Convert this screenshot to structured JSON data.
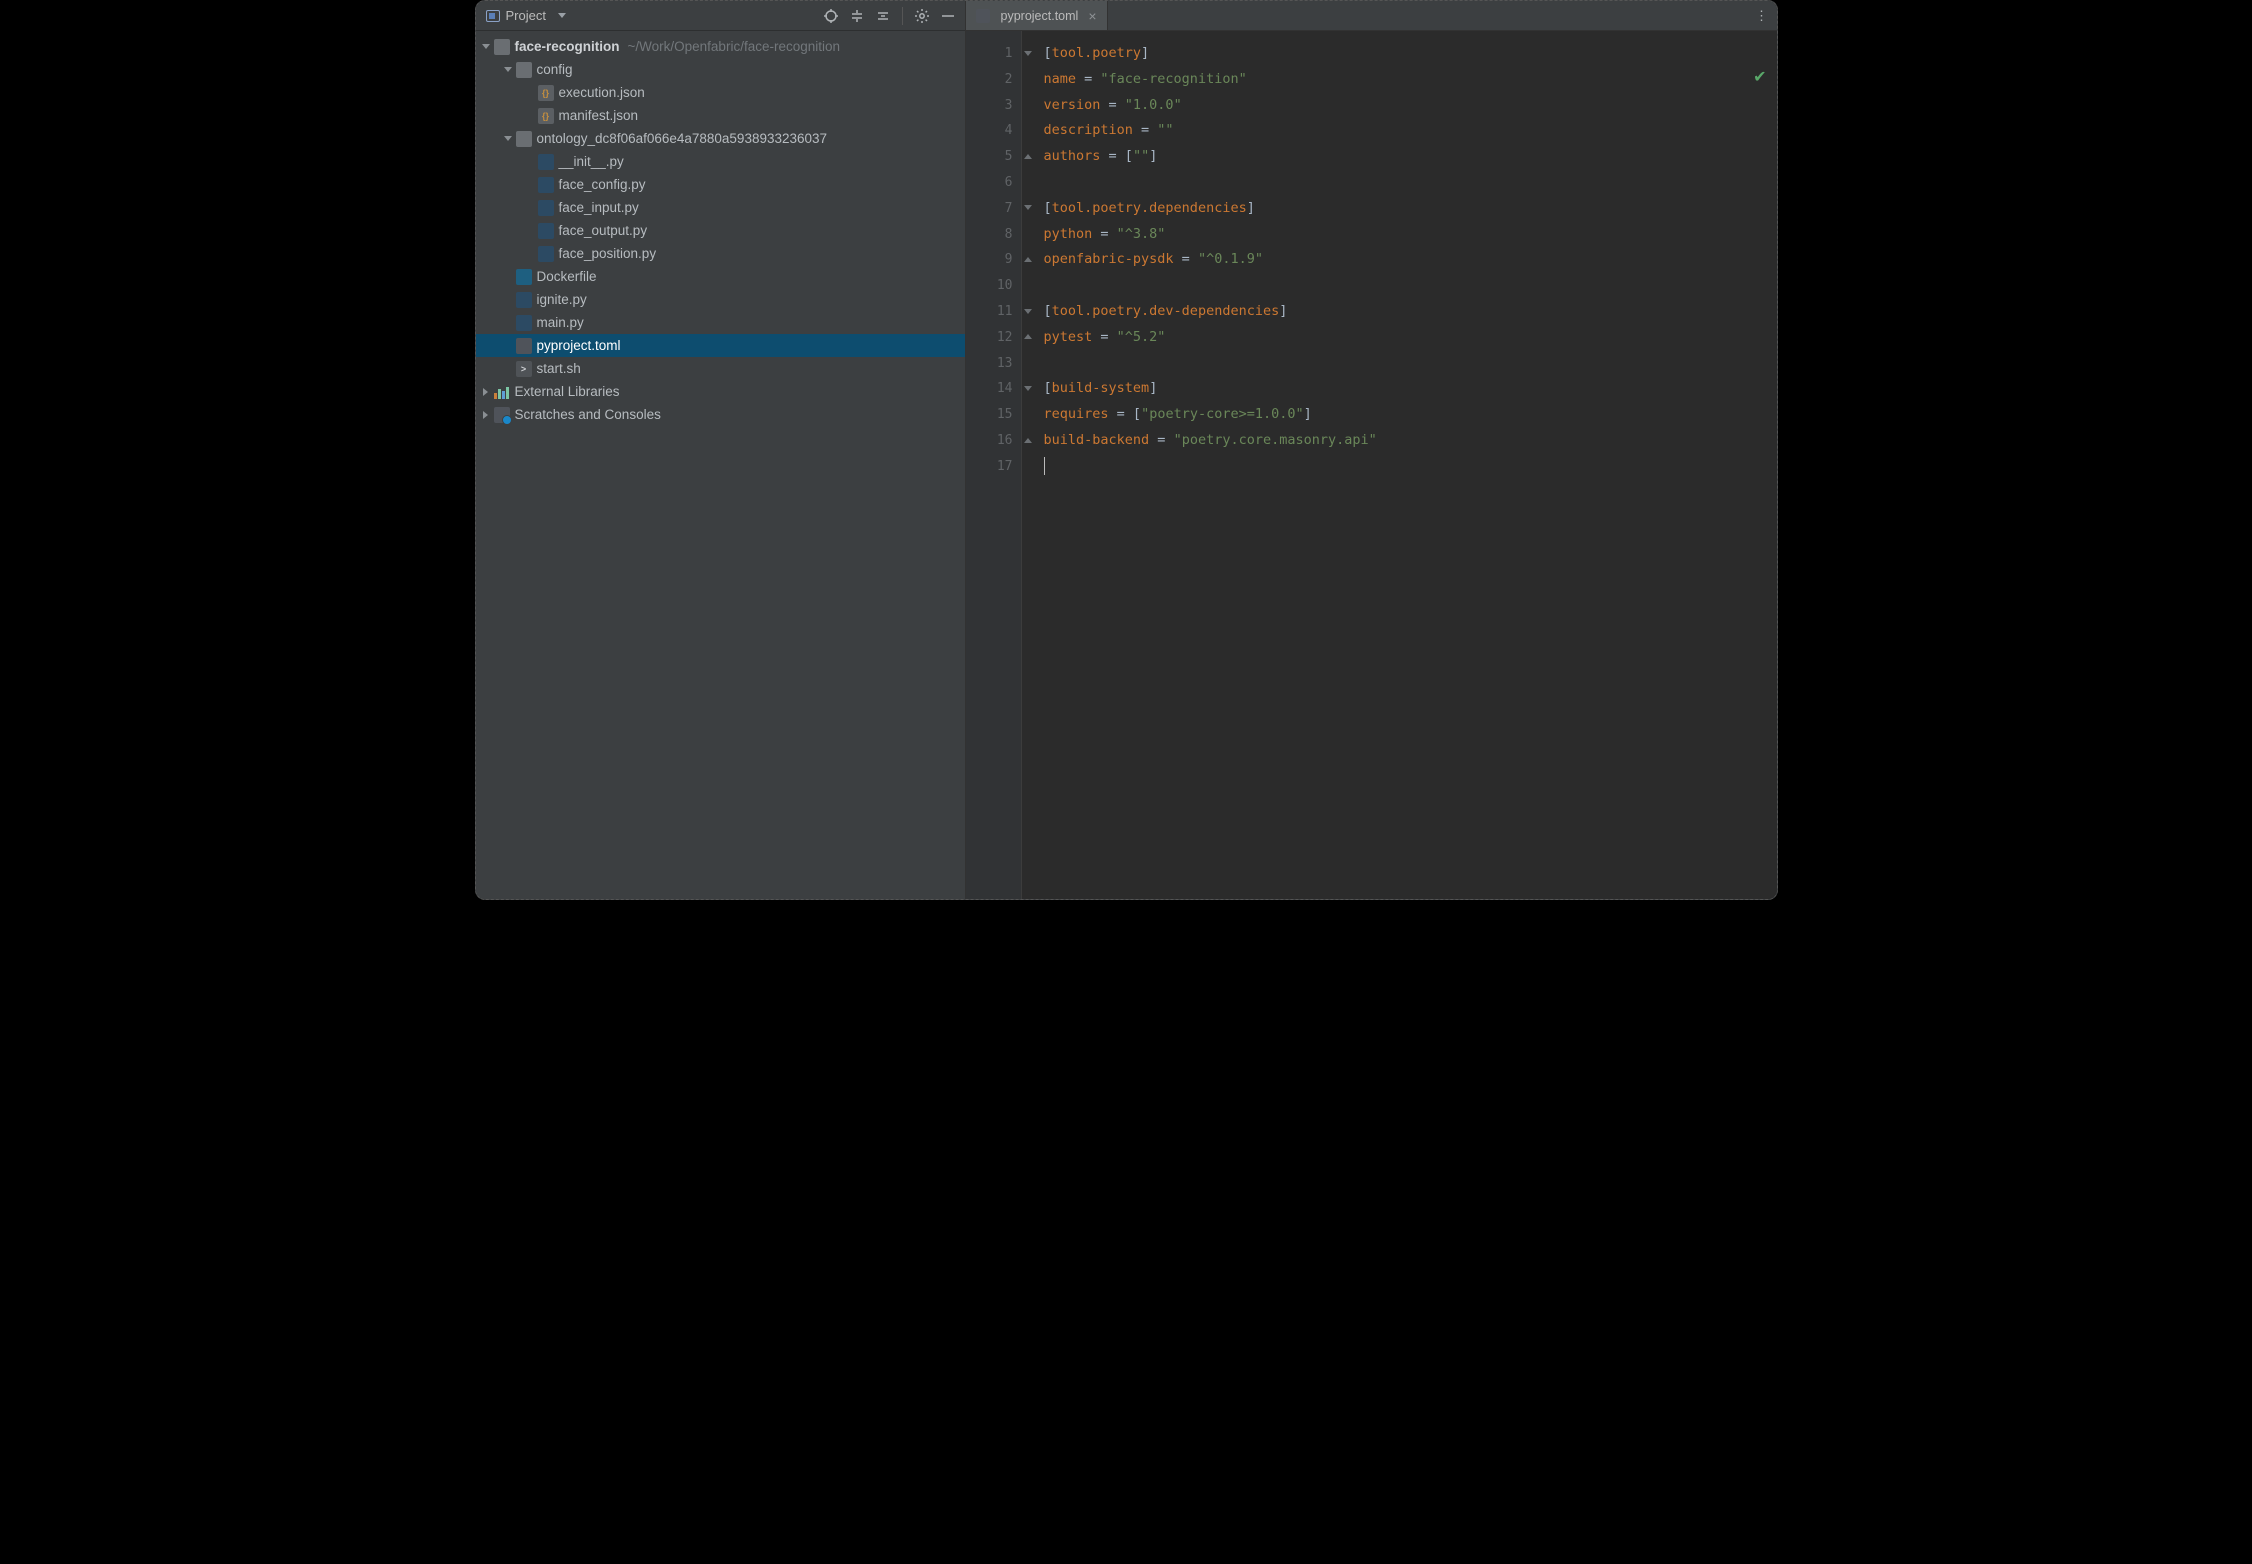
{
  "sidebar": {
    "title": "Project",
    "root": {
      "name": "face-recognition",
      "path": "~/Work/Openfabric/face-recognition"
    },
    "items": [
      {
        "label": "config",
        "kind": "folder",
        "depth": 1,
        "open": true
      },
      {
        "label": "execution.json",
        "kind": "json",
        "depth": 2
      },
      {
        "label": "manifest.json",
        "kind": "json",
        "depth": 2
      },
      {
        "label": "ontology_dc8f06af066e4a7880a5938933236037",
        "kind": "folder",
        "depth": 1,
        "open": true
      },
      {
        "label": "__init__.py",
        "kind": "py",
        "depth": 2
      },
      {
        "label": "face_config.py",
        "kind": "py",
        "depth": 2
      },
      {
        "label": "face_input.py",
        "kind": "py",
        "depth": 2
      },
      {
        "label": "face_output.py",
        "kind": "py",
        "depth": 2
      },
      {
        "label": "face_position.py",
        "kind": "py",
        "depth": 2
      },
      {
        "label": "Dockerfile",
        "kind": "docker",
        "depth": 1
      },
      {
        "label": "ignite.py",
        "kind": "py",
        "depth": 1
      },
      {
        "label": "main.py",
        "kind": "py",
        "depth": 1
      },
      {
        "label": "pyproject.toml",
        "kind": "toml",
        "depth": 1,
        "selected": true
      },
      {
        "label": "start.sh",
        "kind": "sh",
        "depth": 1
      }
    ],
    "external": "External Libraries",
    "scratches": "Scratches and Consoles"
  },
  "editor": {
    "tab": {
      "label": "pyproject.toml"
    },
    "lines": 17,
    "toml": {
      "sections": [
        {
          "header": "tool.poetry",
          "entries": [
            {
              "key": "name",
              "value": "\"face-recognition\""
            },
            {
              "key": "version",
              "value": "\"1.0.0\""
            },
            {
              "key": "description",
              "value": "\"\""
            },
            {
              "key": "authors",
              "value": "[\"\"]"
            }
          ]
        },
        {
          "header": "tool.poetry.dependencies",
          "entries": [
            {
              "key": "python",
              "value": "\"^3.8\""
            },
            {
              "key": "openfabric-pysdk",
              "value": "\"^0.1.9\""
            }
          ]
        },
        {
          "header": "tool.poetry.dev-dependencies",
          "entries": [
            {
              "key": "pytest",
              "value": "\"^5.2\""
            }
          ]
        },
        {
          "header": "build-system",
          "entries": [
            {
              "key": "requires",
              "value": "[\"poetry-core>=1.0.0\"]"
            },
            {
              "key": "build-backend",
              "value": "\"poetry.core.masonry.api\""
            }
          ]
        }
      ]
    }
  }
}
